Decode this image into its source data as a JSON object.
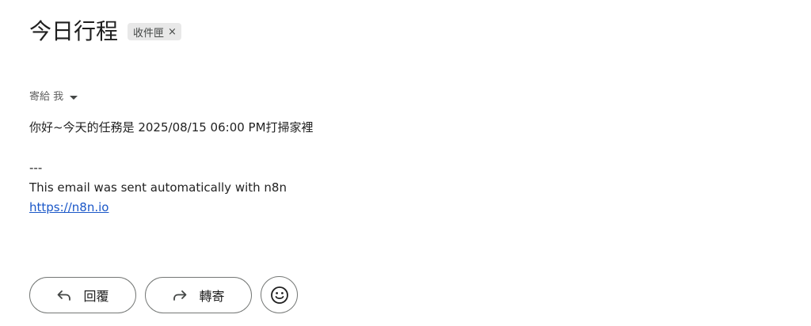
{
  "email": {
    "subject": "今日行程",
    "label": "收件匣",
    "label_remove": "×",
    "recipients": "寄給 我",
    "body_lines": [
      "你好~今天的任務是 2025/08/15 06:00 PM打掃家裡",
      "---",
      "This email was sent automatically with n8n"
    ],
    "link_text": "https://n8n.io"
  },
  "actions": {
    "reply_label": "回覆",
    "forward_label": "轉寄"
  },
  "icons": {
    "label_remove": "close-icon",
    "recipients_dropdown": "caret-down-icon",
    "reply": "reply-arrow-icon",
    "forward": "forward-arrow-icon",
    "emoji": "smiley-icon"
  },
  "colors": {
    "link": "#1a57c8",
    "chip_background": "#e8e8e8",
    "button_border": "#747775"
  }
}
